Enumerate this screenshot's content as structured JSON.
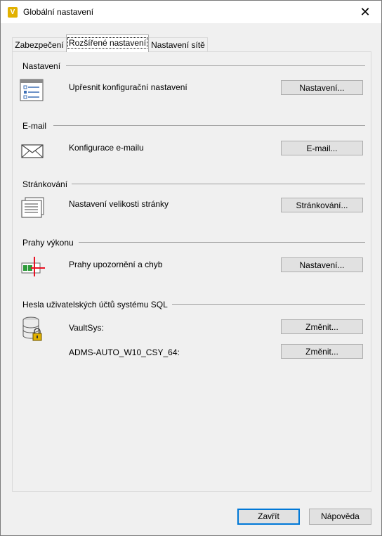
{
  "window": {
    "title": "Globální nastavení",
    "close_glyph": "✕",
    "app_icon_letter": "V"
  },
  "tabs": [
    {
      "label": "Zabezpečení"
    },
    {
      "label": "Rozšířené nastavení",
      "selected": true
    },
    {
      "label": "Nastavení sítě"
    }
  ],
  "groups": {
    "settings": {
      "title": "Nastavení",
      "row_label": "Upřesnit konfigurační nastavení",
      "button": "Nastavení...",
      "icon": "settings-list-icon"
    },
    "email": {
      "title": "E-mail",
      "row_label": "Konfigurace e-mailu",
      "button": "E-mail...",
      "icon": "envelope-icon"
    },
    "paging": {
      "title": "Stránkování",
      "row_label": "Nastavení velikosti stránky",
      "button": "Stránkování...",
      "icon": "document-pages-icon"
    },
    "thresholds": {
      "title": "Prahy výkonu",
      "row_label": "Prahy upozornění a chyb",
      "button": "Nastavení...",
      "icon": "performance-threshold-icon"
    },
    "sql_passwords": {
      "title": "Hesla uživatelských účtů systému SQL",
      "icon": "database-lock-icon",
      "accounts": [
        {
          "label": "VaultSys:",
          "button": "Změnit..."
        },
        {
          "label": "ADMS-AUTO_W10_CSY_64:",
          "button": "Změnit..."
        }
      ]
    }
  },
  "footer": {
    "close_button": "Zavřít",
    "help_button": "Nápověda"
  },
  "colors": {
    "dialog_bg": "#f0f0f0",
    "default_button_border": "#0078d7",
    "app_icon": "#e2b100",
    "threshold_red": "#e81123",
    "threshold_green": "#2e9b3a"
  }
}
